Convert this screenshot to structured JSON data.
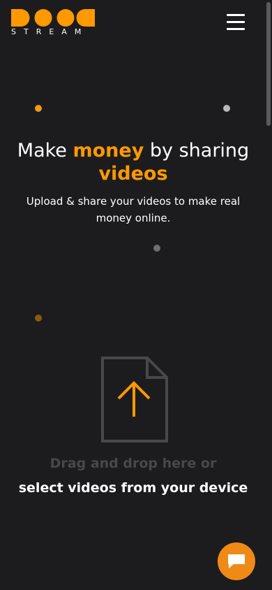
{
  "brand": {
    "word": "STREAM",
    "accent_color": "#ff9900"
  },
  "header": {
    "menu_icon": "hamburger-menu-icon"
  },
  "hero": {
    "title_pre": "Make ",
    "title_highlight_1": "money",
    "title_mid": " by sharing ",
    "title_highlight_2": "videos",
    "subtitle": "Upload & share your videos to make real money online."
  },
  "upload": {
    "icon": "file-upload-icon",
    "drag_text": "Drag and drop here or",
    "select_text": "select videos from your device"
  },
  "chat": {
    "icon": "chat-bubble-icon",
    "color": "#f08a16"
  }
}
